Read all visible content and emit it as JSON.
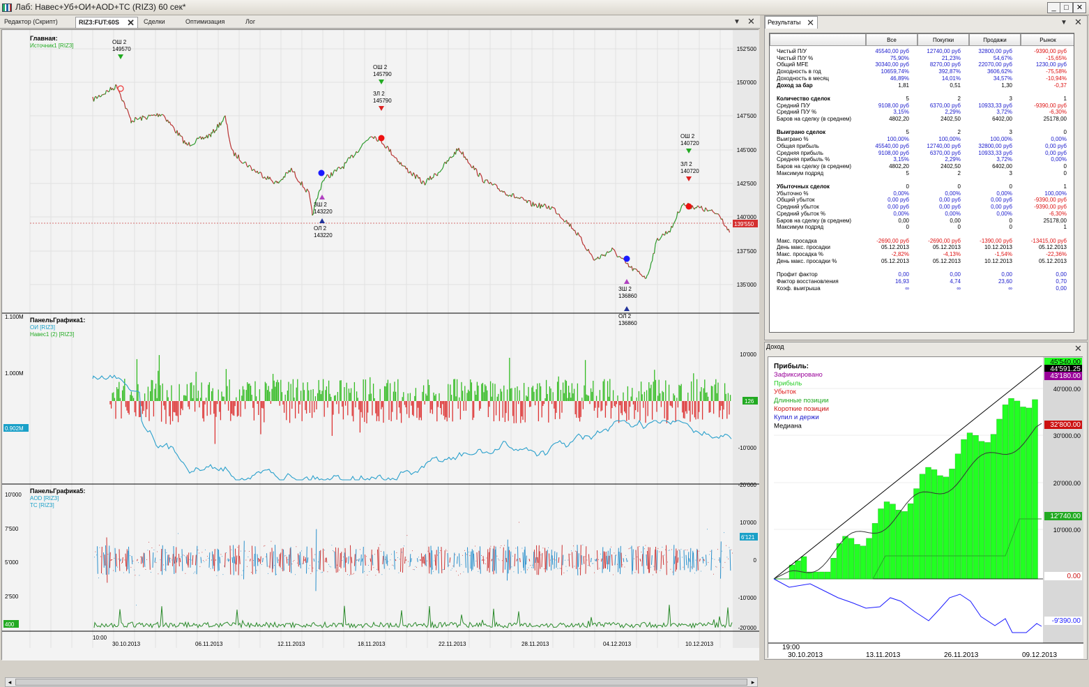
{
  "window": {
    "title": "Лаб: Навес+Уб+ОИ+AOD+TC (RIZ3) 60 сек*"
  },
  "tabs": [
    {
      "label": "Редактор (Скрипт)"
    },
    {
      "label": "RIZ3:FUT:60S"
    },
    {
      "label": "Сделки"
    },
    {
      "label": "Оптимизация"
    },
    {
      "label": "Лог"
    }
  ],
  "main_panel": {
    "title": "Главная:",
    "source": "Источник1 [RIZ3]",
    "y_ticks": [
      "152'500",
      "150'000",
      "147'500",
      "145'000",
      "142'500",
      "140'000",
      "137'500",
      "135'000"
    ],
    "current_price": "139'550",
    "signals": [
      {
        "lines": [
          "ОШ 2",
          "149570"
        ]
      },
      {
        "lines": [
          "ОШ 2",
          "145790"
        ]
      },
      {
        "lines": [
          "ЗЛ 2",
          "145790"
        ]
      },
      {
        "lines": [
          "ЗШ 2",
          "143220"
        ]
      },
      {
        "lines": [
          "ОЛ 2",
          "143220"
        ]
      },
      {
        "lines": [
          "ЗШ 2",
          "136860"
        ]
      },
      {
        "lines": [
          "ОЛ 2",
          "136860"
        ]
      },
      {
        "lines": [
          "ОШ 2",
          "140720"
        ]
      },
      {
        "lines": [
          "ЗЛ 2",
          "140720"
        ]
      }
    ]
  },
  "panel1": {
    "title": "ПанельГрафика1:",
    "series": [
      "ОИ [RIZ3]",
      "Навес1 (2) [RIZ3]"
    ],
    "left_ticks": [
      "1.100M",
      "1.000M"
    ],
    "left_badge": "0.902M",
    "right_ticks": [
      "10'000",
      "-10'000",
      "-20'000"
    ],
    "right_badge": "126"
  },
  "panel5": {
    "title": "ПанельГрафика5:",
    "series": [
      "AOD [RIZ3]",
      "TC [RIZ3]"
    ],
    "left_ticks": [
      "10'000",
      "7'500",
      "5'000",
      "2'500"
    ],
    "left_badge": "400",
    "right_ticks": [
      "10'000",
      "0",
      "-10'000",
      "-20'000"
    ],
    "right_badge": "6'121"
  },
  "x_axis": {
    "time": "10:00",
    "dates": [
      "30.10.2013",
      "06.11.2013",
      "12.11.2013",
      "18.11.2013",
      "22.11.2013",
      "28.11.2013",
      "04.12.2013",
      "10.12.2013"
    ]
  },
  "results": {
    "title": "Результаты",
    "columns": [
      "Все",
      "Покупки",
      "Продажи",
      "Рынок"
    ],
    "rows": [
      {
        "label": "Чистый П/У",
        "v": [
          "45540,00 руб",
          "12740,00 руб",
          "32800,00 руб",
          "-9390,00 руб"
        ]
      },
      {
        "label": "Чистый П/У %",
        "v": [
          "75,90%",
          "21,23%",
          "54,67%",
          "-15,65%"
        ]
      },
      {
        "label": "Общий MFE",
        "v": [
          "30340,00 руб",
          "8270,00 руб",
          "22070,00 руб",
          "1230,00 руб"
        ]
      },
      {
        "label": "Доходность в год",
        "v": [
          "10659,74%",
          "392,87%",
          "3606,62%",
          "-75,58%"
        ]
      },
      {
        "label": "Доходность в месяц",
        "v": [
          "46,89%",
          "14,01%",
          "34,57%",
          "-10,94%"
        ]
      },
      {
        "label": "Доход за бар",
        "bold": true,
        "v": [
          "1,81",
          "0,51",
          "1,30",
          "-0,37"
        ]
      },
      {
        "label": "",
        "v": [
          "",
          "",
          "",
          ""
        ]
      },
      {
        "label": "Количество сделок",
        "bold": true,
        "v": [
          "5",
          "2",
          "3",
          "1"
        ]
      },
      {
        "label": "Средний П/У",
        "v": [
          "9108,00 руб",
          "6370,00 руб",
          "10933,33 руб",
          "-9390,00 руб"
        ]
      },
      {
        "label": "Средний П/У %",
        "v": [
          "3,15%",
          "2,29%",
          "3,72%",
          "-6,30%"
        ]
      },
      {
        "label": "Баров на сделку (в среднем)",
        "v": [
          "4802,20",
          "2402,50",
          "6402,00",
          "25178,00"
        ]
      },
      {
        "label": "",
        "v": [
          "",
          "",
          "",
          ""
        ]
      },
      {
        "label": "Выиграно сделок",
        "bold": true,
        "v": [
          "5",
          "2",
          "3",
          "0"
        ]
      },
      {
        "label": "Выиграно %",
        "v": [
          "100,00%",
          "100,00%",
          "100,00%",
          "0,00%"
        ]
      },
      {
        "label": "Общая прибыль",
        "v": [
          "45540,00 руб",
          "12740,00 руб",
          "32800,00 руб",
          "0,00 руб"
        ]
      },
      {
        "label": "Средняя прибыль",
        "v": [
          "9108,00 руб",
          "6370,00 руб",
          "10933,33 руб",
          "0,00 руб"
        ]
      },
      {
        "label": "Средняя прибыль %",
        "v": [
          "3,15%",
          "2,29%",
          "3,72%",
          "0,00%"
        ]
      },
      {
        "label": "Баров на сделку (в среднем)",
        "v": [
          "4802,20",
          "2402,50",
          "6402,00",
          "0"
        ]
      },
      {
        "label": "Максимум подряд",
        "v": [
          "5",
          "2",
          "3",
          "0"
        ]
      },
      {
        "label": "",
        "v": [
          "",
          "",
          "",
          ""
        ]
      },
      {
        "label": "Убыточных сделок",
        "bold": true,
        "v": [
          "0",
          "0",
          "0",
          "1"
        ]
      },
      {
        "label": "Убыточно %",
        "v": [
          "0,00%",
          "0,00%",
          "0,00%",
          "100,00%"
        ]
      },
      {
        "label": "Общий убыток",
        "v": [
          "0,00 руб",
          "0,00 руб",
          "0,00 руб",
          "-9390,00 руб"
        ]
      },
      {
        "label": "Средний убыток",
        "v": [
          "0,00 руб",
          "0,00 руб",
          "0,00 руб",
          "-9390,00 руб"
        ]
      },
      {
        "label": "Средний убыток %",
        "v": [
          "0,00%",
          "0,00%",
          "0,00%",
          "-6,30%"
        ]
      },
      {
        "label": "Баров на сделку (в среднем)",
        "v": [
          "0,00",
          "0,00",
          "0",
          "25178,00"
        ]
      },
      {
        "label": "Максимум подряд",
        "v": [
          "0",
          "0",
          "0",
          "1"
        ]
      },
      {
        "label": "",
        "v": [
          "",
          "",
          "",
          ""
        ]
      },
      {
        "label": "Макс. просадка",
        "v": [
          "-2690,00 руб",
          "-2690,00 руб",
          "-1390,00 руб",
          "-13415,00 руб"
        ]
      },
      {
        "label": "День макс. просадки",
        "v": [
          "05.12.2013",
          "05.12.2013",
          "10.12.2013",
          "05.12.2013"
        ]
      },
      {
        "label": "Макс. просадка %",
        "v": [
          "-2,82%",
          "-4,13%",
          "-1,54%",
          "-22,36%"
        ]
      },
      {
        "label": "День макс. просадки %",
        "v": [
          "05.12.2013",
          "05.12.2013",
          "10.12.2013",
          "05.12.2013"
        ]
      },
      {
        "label": "",
        "v": [
          "",
          "",
          "",
          ""
        ]
      },
      {
        "label": "Профит фактор",
        "v": [
          "0,00",
          "0,00",
          "0,00",
          "0,00"
        ]
      },
      {
        "label": "Фактор восстановления",
        "v": [
          "16,93",
          "4,74",
          "23,60",
          "0,70"
        ]
      },
      {
        "label": "Коэф. выигрыша",
        "v": [
          "∞",
          "∞",
          "∞",
          "0,00"
        ]
      }
    ]
  },
  "income": {
    "title": "Доход",
    "legend": [
      "Прибыль:",
      "Зафиксировано",
      "Прибыль",
      "Убыток",
      "Длинные позиции",
      "Короткие позиции",
      "Купил и держи",
      "Медиана"
    ],
    "y_ticks": [
      "40'000.00",
      "30'000.00",
      "20'000.00",
      "10'000.00"
    ],
    "badges": [
      "45'540.00",
      "44'591.25",
      "43'180.00",
      "32'800.00",
      "12'740.00",
      "0.00",
      "-9'390.00"
    ],
    "time": "19:00",
    "dates": [
      "30.10.2013",
      "13.11.2013",
      "26.11.2013",
      "09.12.2013"
    ]
  },
  "colors": {
    "green": "#22aa22",
    "red": "#dd2222",
    "blue": "#1a1aff",
    "cyan": "#1aa0c8",
    "lime": "#22ff22"
  }
}
